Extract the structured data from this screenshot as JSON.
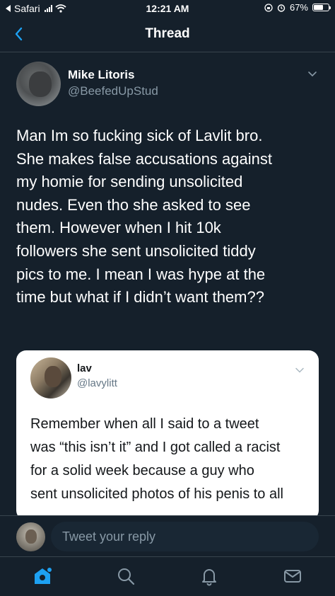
{
  "status_bar": {
    "back_app": "Safari",
    "time": "12:21 AM",
    "battery": "67%",
    "battery_level": 0.67
  },
  "nav": {
    "title": "Thread",
    "back_icon": "chevron-left-icon"
  },
  "tweet": {
    "display_name": "Mike Litoris",
    "handle": "@BeefedUpStud",
    "text": "Man Im so fucking sick of Lavlit bro.\nShe makes false accusations against\nmy homie for sending unsolicited\nnudes. Even tho she asked to see\nthem. However when I hit 10k\nfollowers she sent unsolicited tiddy\npics to me. I mean I was hype at the\ntime but what if I didn’t want them??"
  },
  "quote": {
    "display_name": "lav",
    "handle": "@lavylitt",
    "text": "Remember when all I said to a tweet\nwas “this isn’t it” and I got called a racist\nfor a solid week because a guy who\nsent unsolicited photos of his penis to all"
  },
  "reply": {
    "placeholder": "Tweet your reply"
  },
  "tab_bar": {
    "items": [
      "home-icon",
      "search-icon",
      "notifications-icon",
      "messages-icon"
    ],
    "active_color": "#1da1f2",
    "inactive_color": "#8899a6"
  },
  "colors": {
    "background": "#15202b",
    "accent": "#1da1f2",
    "secondary_text": "#8899a6"
  }
}
